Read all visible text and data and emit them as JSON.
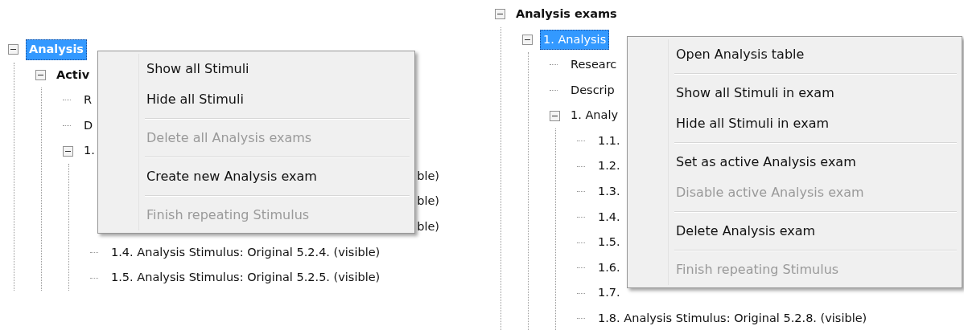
{
  "panels": [
    {
      "tree": [
        {
          "kind": "node",
          "label": "Analysis",
          "selected": true,
          "bold": true,
          "expanded": true,
          "children": [
            {
              "kind": "node",
              "label": "Activ",
              "selected": false,
              "bold": true,
              "expanded": true,
              "children": [
                {
                  "kind": "node",
                  "label": "R",
                  "selected": false,
                  "bold": false
                },
                {
                  "kind": "node",
                  "label": "D",
                  "selected": false,
                  "bold": false
                },
                {
                  "kind": "node",
                  "label": "1.",
                  "selected": false,
                  "bold": false,
                  "expanded": true,
                  "children": [
                    {
                      "kind": "tail",
                      "label": "ble)",
                      "selected": false,
                      "bold": false
                    },
                    {
                      "kind": "tail",
                      "label": "ble)",
                      "selected": false,
                      "bold": false
                    },
                    {
                      "kind": "tail",
                      "label": "ble)",
                      "selected": false,
                      "bold": false
                    },
                    {
                      "kind": "node",
                      "label": "1.4. Analysis Stimulus: Original 5.2.4. (visible)",
                      "selected": false,
                      "bold": false
                    },
                    {
                      "kind": "node",
                      "label": "1.5. Analysis Stimulus: Original 5.2.5. (visible)",
                      "selected": false,
                      "bold": false
                    }
                  ]
                }
              ]
            }
          ]
        }
      ],
      "menu": [
        {
          "kind": "item",
          "label": "Show all Stimuli",
          "disabled": false
        },
        {
          "kind": "item",
          "label": "Hide all Stimuli",
          "disabled": false
        },
        {
          "kind": "separator"
        },
        {
          "kind": "item",
          "label": "Delete all Analysis exams",
          "disabled": true
        },
        {
          "kind": "separator"
        },
        {
          "kind": "item",
          "label": "Create new Analysis exam",
          "disabled": false
        },
        {
          "kind": "separator"
        },
        {
          "kind": "item",
          "label": "Finish repeating Stimulus",
          "disabled": true
        }
      ]
    },
    {
      "tree": [
        {
          "kind": "node",
          "label": "Analysis exams",
          "selected": false,
          "bold": true,
          "expanded": true,
          "children": [
            {
              "kind": "node",
              "label": "1. Analysis",
              "selected": true,
              "bold": false,
              "expanded": true,
              "children": [
                {
                  "kind": "node",
                  "label": "Researc",
                  "selected": false,
                  "bold": false
                },
                {
                  "kind": "node",
                  "label": "Descrip",
                  "selected": false,
                  "bold": false
                },
                {
                  "kind": "node",
                  "label": "1. Analy",
                  "selected": false,
                  "bold": false,
                  "expanded": true,
                  "children": [
                    {
                      "kind": "node",
                      "label": "1.1.",
                      "selected": false,
                      "bold": false
                    },
                    {
                      "kind": "node",
                      "label": "1.2.",
                      "selected": false,
                      "bold": false
                    },
                    {
                      "kind": "node",
                      "label": "1.3.",
                      "selected": false,
                      "bold": false
                    },
                    {
                      "kind": "node",
                      "label": "1.4.",
                      "selected": false,
                      "bold": false
                    },
                    {
                      "kind": "node",
                      "label": "1.5.",
                      "selected": false,
                      "bold": false
                    },
                    {
                      "kind": "node",
                      "label": "1.6.",
                      "selected": false,
                      "bold": false
                    },
                    {
                      "kind": "node",
                      "label": "1.7.",
                      "selected": false,
                      "bold": false
                    },
                    {
                      "kind": "node",
                      "label": "1.8. Analysis Stimulus: Original 5.2.8. (visible)",
                      "selected": false,
                      "bold": false
                    }
                  ]
                }
              ]
            }
          ]
        }
      ],
      "menu": [
        {
          "kind": "item",
          "label": "Open Analysis table",
          "disabled": false
        },
        {
          "kind": "separator"
        },
        {
          "kind": "item",
          "label": "Show all Stimuli in exam",
          "disabled": false
        },
        {
          "kind": "item",
          "label": "Hide all Stimuli in exam",
          "disabled": false
        },
        {
          "kind": "separator"
        },
        {
          "kind": "item",
          "label": "Set as active Analysis exam",
          "disabled": false
        },
        {
          "kind": "item",
          "label": "Disable active Analysis exam",
          "disabled": true
        },
        {
          "kind": "separator"
        },
        {
          "kind": "item",
          "label": "Delete Analysis exam",
          "disabled": false
        },
        {
          "kind": "separator"
        },
        {
          "kind": "item",
          "label": "Finish repeating Stimulus",
          "disabled": true
        }
      ]
    }
  ]
}
